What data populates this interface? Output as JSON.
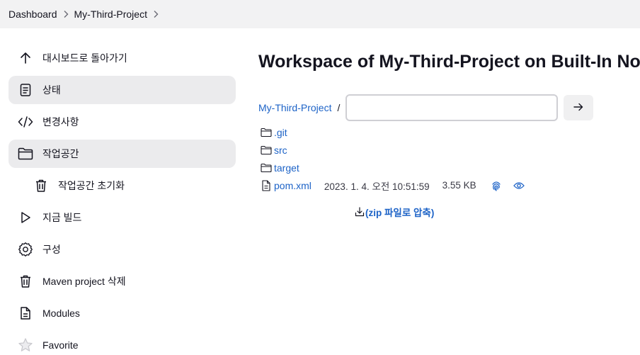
{
  "breadcrumb": {
    "items": [
      "Dashboard",
      "My-Third-Project"
    ]
  },
  "sidebar": {
    "items": [
      {
        "label": "대시보드로 돌아가기",
        "icon": "arrow-up-icon"
      },
      {
        "label": "상태",
        "icon": "document-icon"
      },
      {
        "label": "변경사항",
        "icon": "code-icon"
      },
      {
        "label": "작업공간",
        "icon": "folder-icon"
      },
      {
        "label": "작업공간 초기화",
        "icon": "trash-icon"
      },
      {
        "label": "지금 빌드",
        "icon": "play-icon"
      },
      {
        "label": "구성",
        "icon": "gear-icon"
      },
      {
        "label": "Maven project 삭제",
        "icon": "trash-icon"
      },
      {
        "label": "Modules",
        "icon": "document-icon"
      },
      {
        "label": "Favorite",
        "icon": "star-icon"
      }
    ]
  },
  "main": {
    "title": "Workspace of My-Third-Project on Built-In Node",
    "path": {
      "root": "My-Third-Project",
      "separator": "/",
      "input_value": ""
    },
    "files": [
      {
        "name": ".git",
        "type": "folder"
      },
      {
        "name": "src",
        "type": "folder"
      },
      {
        "name": "target",
        "type": "folder"
      },
      {
        "name": "pom.xml",
        "type": "file",
        "modified": "2023. 1. 4. 오전 10:51:59",
        "size": "3.55 KB"
      }
    ],
    "zip_label": "(zip 파일로 압축)"
  },
  "colors": {
    "accent": "#1d63c7",
    "topbar": "#f2f2f3",
    "active_item": "#ebebed"
  }
}
